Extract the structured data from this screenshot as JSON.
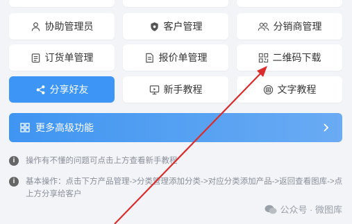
{
  "colors": {
    "primary": "#3d96f5",
    "arrow": "#d92d2d",
    "background": "#f3f4f8"
  },
  "grid": {
    "row1": [
      {
        "label": "协助管理员",
        "icon": "user-icon"
      },
      {
        "label": "客户管理",
        "icon": "shield-icon"
      },
      {
        "label": "分销商管理",
        "icon": "users-icon"
      }
    ],
    "row2": [
      {
        "label": "订货单管理",
        "icon": "clipboard-icon"
      },
      {
        "label": "报价单管理",
        "icon": "document-icon"
      },
      {
        "label": "二维码下载",
        "icon": "qrcode-icon"
      }
    ],
    "row3": [
      {
        "label": "分享好友",
        "icon": "share-icon"
      },
      {
        "label": "新手教程",
        "icon": "monitor-icon"
      },
      {
        "label": "文字教程",
        "icon": "text-circle-icon"
      }
    ]
  },
  "more": {
    "label": "更多高级功能",
    "icon": "grid-icon"
  },
  "tips": {
    "tip1": "操作有不懂的问题可点击上方查看新手教程",
    "tip2": "基本操作：点击下方产品管理->分类管理添加分类->对应分类添加产品->返回查看图库->点上方分享给客户"
  },
  "watermark": {
    "label": "公众号 · 微图库"
  }
}
